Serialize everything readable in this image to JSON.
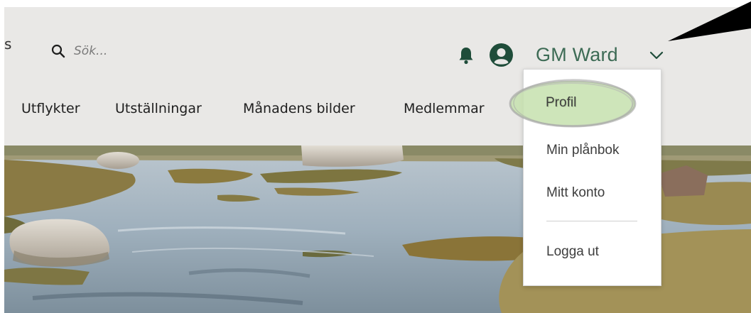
{
  "header": {
    "edge_glyph": "s",
    "search": {
      "placeholder": "Sök...",
      "icon": "search-icon"
    },
    "notifications": {
      "icon": "bell-icon"
    },
    "user": {
      "name": "GM Ward",
      "avatar_icon": "user-avatar-icon",
      "menu_icon": "chevron-down-icon"
    }
  },
  "nav": {
    "items": [
      {
        "label": "Utflykter"
      },
      {
        "label": "Utställningar"
      },
      {
        "label": "Månadens bilder"
      },
      {
        "label": "Medlemmar"
      }
    ]
  },
  "user_menu": {
    "items": [
      {
        "label": "Profil"
      },
      {
        "label": "Min plånbok"
      },
      {
        "label": "Mitt konto"
      },
      {
        "label": "Logga ut"
      }
    ],
    "highlighted": "Profil"
  },
  "colors": {
    "header_bg": "#e9e8e6",
    "brand_green": "#1f4d3a",
    "username_green": "#3d6b55",
    "highlight_green": "#c5e0ae"
  }
}
